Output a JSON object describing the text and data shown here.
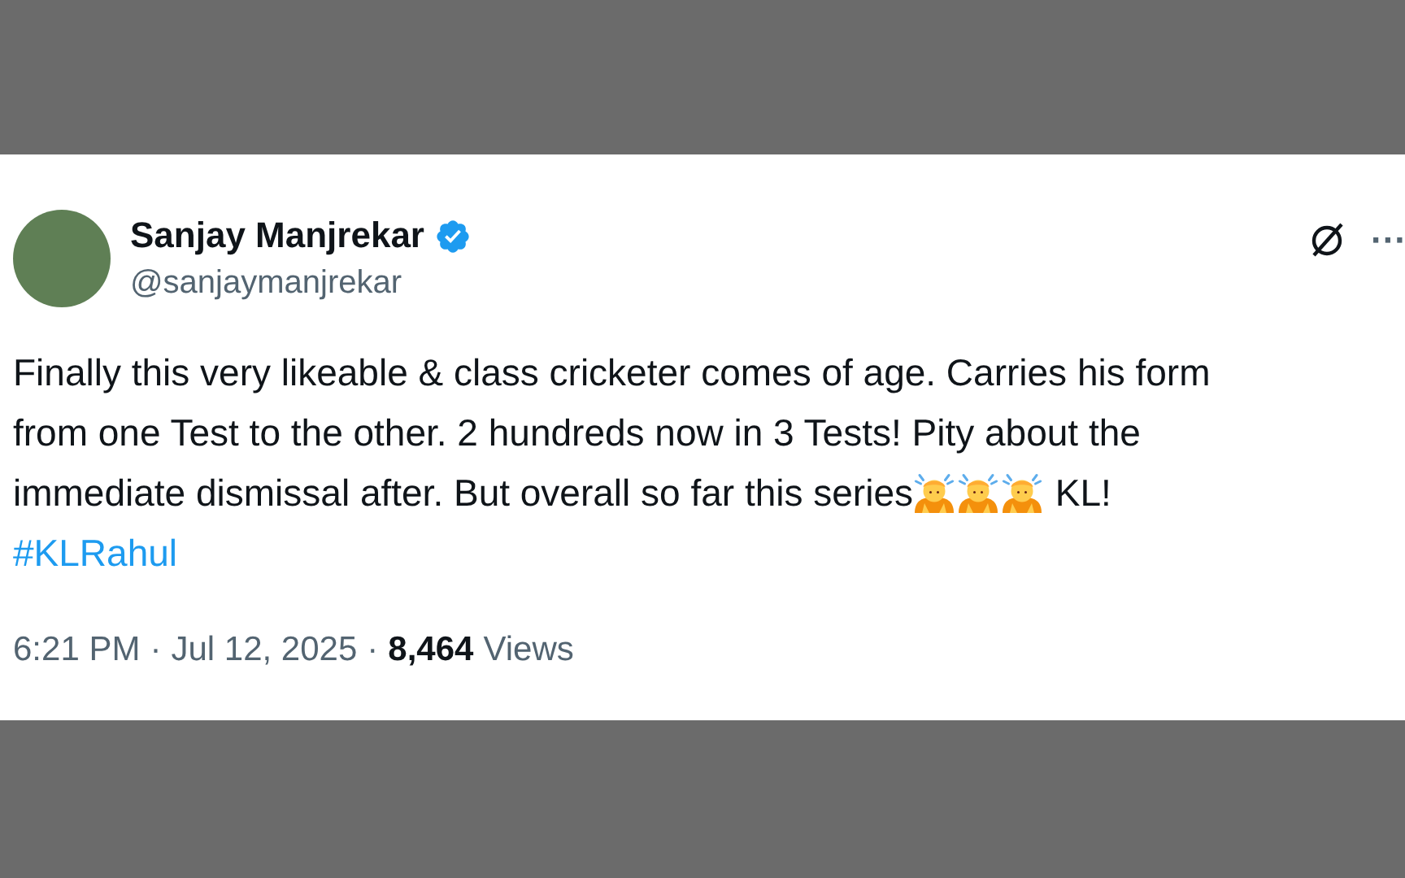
{
  "author": {
    "name": "Sanjay Manjrekar",
    "verified": true,
    "handle": "@sanjaymanjrekar"
  },
  "body_lines": [
    [
      {
        "kind": "text",
        "text": "Finally this very likeable & class cricketer comes of age. Carries his form"
      }
    ],
    [
      {
        "kind": "text",
        "text": "from one Test to the other. 2 hundreds now in 3 Tests! Pity about the"
      }
    ],
    [
      {
        "kind": "text",
        "text": "immediate dismissal after. But overall so far this series"
      },
      {
        "kind": "emoji"
      },
      {
        "kind": "emoji"
      },
      {
        "kind": "emoji"
      },
      {
        "kind": "text",
        "text": " KL!"
      }
    ],
    [
      {
        "kind": "hashtag",
        "text": "#KLRahul"
      }
    ]
  ],
  "meta": {
    "time": "6:21 PM",
    "separator_1": "·",
    "date": "Jul 12, 2025",
    "separator_2": "·",
    "views_count": "8,464",
    "views_label": "Views"
  },
  "more_menu": "···"
}
